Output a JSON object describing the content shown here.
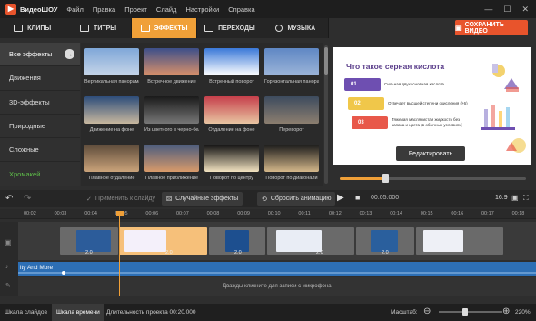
{
  "window": {
    "app_name": "ВидеоШОУ",
    "menu": [
      "Файл",
      "Правка",
      "Проект",
      "Слайд",
      "Настройки",
      "Справка"
    ],
    "controls": [
      "—",
      "☐",
      "✕"
    ]
  },
  "tabs": [
    {
      "label": "КЛИПЫ",
      "active": false
    },
    {
      "label": "ТИТРЫ",
      "active": false
    },
    {
      "label": "ЭФФЕКТЫ",
      "active": true
    },
    {
      "label": "ПЕРЕХОДЫ",
      "active": false
    },
    {
      "label": "МУЗЫКА",
      "active": false
    }
  ],
  "save_button": "СОХРАНИТЬ ВИДЕО",
  "categories": [
    {
      "label": "Все эффекты",
      "active": true
    },
    {
      "label": "Движения"
    },
    {
      "label": "3D-эффекты"
    },
    {
      "label": "Природные"
    },
    {
      "label": "Сложные"
    },
    {
      "label": "Хромакей",
      "green": true
    }
  ],
  "effects": [
    {
      "label": "Вертикальная панорама",
      "c1": "#7fa7d8",
      "c2": "#c6d5e8"
    },
    {
      "label": "Встречное движение",
      "c1": "#3c4f8a",
      "c2": "#d8906a"
    },
    {
      "label": "Встречный поворот",
      "c1": "#3a78d8",
      "c2": "#ffffff"
    },
    {
      "label": "Горизонтальная панорама",
      "c1": "#5f87c4",
      "c2": "#9bb4d8"
    },
    {
      "label": "Движение на фоне",
      "c1": "#2d4d7a",
      "c2": "#c7b79e"
    },
    {
      "label": "Из цветного в черно-белое",
      "c1": "#1a1a1a",
      "c2": "#777777"
    },
    {
      "label": "Отдаление на фоне",
      "c1": "#c63f4b",
      "c2": "#e8c5a2"
    },
    {
      "label": "Переворот",
      "c1": "#3d4b5e",
      "c2": "#8c7e6f"
    },
    {
      "label": "Плавное отдаление",
      "c1": "#5e4c3b",
      "c2": "#caa37a"
    },
    {
      "label": "Плавное приближение",
      "c1": "#4c5d7e",
      "c2": "#d89a6a"
    },
    {
      "label": "Поворот по центру",
      "c1": "#111111",
      "c2": "#f2e3c0"
    },
    {
      "label": "Поворот по диагонали",
      "c1": "#1b1b1b",
      "c2": "#d4b78a"
    }
  ],
  "preview": {
    "title": "Что такое серная кислота",
    "items": [
      {
        "num": "01",
        "text": "Сильная двухосновная кислота",
        "color": "#6e4fb1"
      },
      {
        "num": "02",
        "text": "Отвечает высшей степени окисления (+6)",
        "color": "#f0c74a"
      },
      {
        "num": "03",
        "text": "Тяжелая маслянистая жидкость без запаха и цвета (в обычных условиях)",
        "color": "#e8584a"
      }
    ],
    "edit_button": "Редактировать",
    "progress": 0.24
  },
  "actions": {
    "apply_to_slide": "Применить к слайду",
    "random_effects": "Случайные эффекты",
    "reset_animation": "Сбросить анимацию",
    "time": "00:05.000",
    "ratio": "16:9"
  },
  "ruler_ticks": [
    "00:02",
    "00:03",
    "00:04",
    "00:05",
    "00:06",
    "00:07",
    "00:08",
    "00:09",
    "00:10",
    "00:11",
    "00:12",
    "00:13",
    "00:14",
    "00:15",
    "00:16",
    "00:17",
    "00:18"
  ],
  "clip_durations": [
    "2.0",
    "2.0",
    "2.0",
    "2.0",
    "2.0"
  ],
  "audio_track": "ity And More",
  "mic_hint": "Дважды кликните для записи с микрофона",
  "status": {
    "storyboard": "Шкала слайдов",
    "timeline": "Шкала времени",
    "duration": "Длительность проекта 00:20.000",
    "zoom_label": "Масштаб:",
    "zoom_value": "220%"
  },
  "colors": {
    "accent": "#f0a038",
    "save": "#e8542c",
    "audio": "#2d6fb5"
  }
}
